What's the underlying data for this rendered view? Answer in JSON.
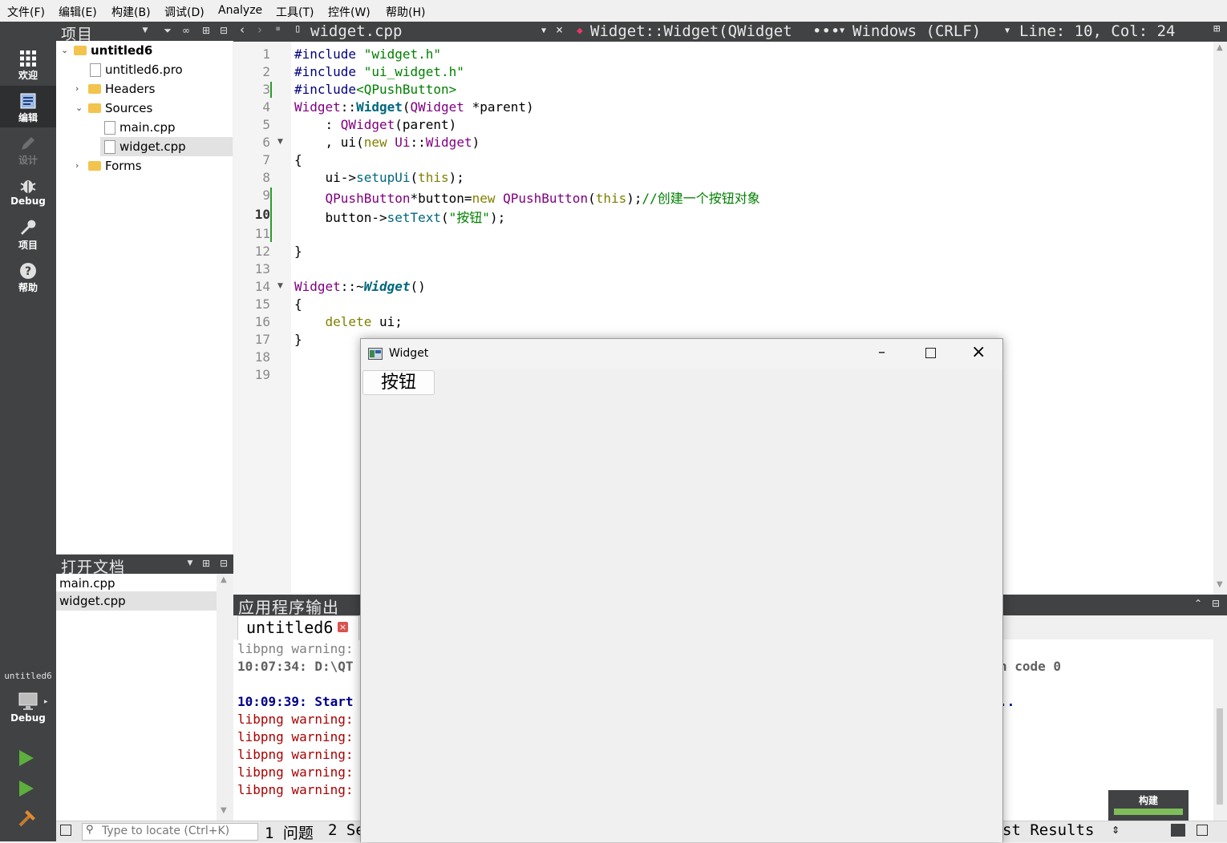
{
  "menu": [
    "文件(F)",
    "编辑(E)",
    "构建(B)",
    "调试(D)",
    "Analyze",
    "工具(T)",
    "控件(W)",
    "帮助(H)"
  ],
  "modes": [
    {
      "label": "欢迎",
      "icon": "grid-icon"
    },
    {
      "label": "编辑",
      "icon": "edit-document-icon"
    },
    {
      "label": "设计",
      "icon": "pencil-icon"
    },
    {
      "label": "Debug",
      "icon": "bug-icon"
    },
    {
      "label": "项目",
      "icon": "wrench-icon"
    },
    {
      "label": "帮助",
      "icon": "help-icon"
    }
  ],
  "kit": {
    "project": "untitled6",
    "config": "Debug"
  },
  "project_pane": {
    "title": "项目"
  },
  "tree": {
    "root": "untitled6",
    "pro": "untitled6.pro",
    "headers": "Headers",
    "sources": "Sources",
    "main": "main.cpp",
    "widget": "widget.cpp",
    "forms": "Forms"
  },
  "open_docs": {
    "title": "打开文档",
    "items": [
      "main.cpp",
      "widget.cpp"
    ]
  },
  "editor_toolbar": {
    "file": "widget.cpp",
    "symbol": "Widget::Widget(QWidget",
    "ellipsis": "•••",
    "line_ending": "Windows (CRLF)",
    "position": "Line: 10, Col: 24"
  },
  "code": {
    "line_numbers": [
      "1",
      "2",
      "3",
      "4",
      "5",
      "6",
      "7",
      "8",
      "9",
      "10",
      "11",
      "12",
      "13",
      "14",
      "15",
      "16",
      "17",
      "18",
      "19"
    ],
    "l1a": "#include ",
    "l1b": "\"widget.h\"",
    "l2a": "#include ",
    "l2b": "\"ui_widget.h\"",
    "l3a": "#include",
    "l3b": "<QPushButton>",
    "l4a": "Widget",
    "l4b": "::",
    "l4c": "Widget",
    "l4d": "(",
    "l4e": "QWidget",
    "l4f": " *parent)",
    "l5a": "    : ",
    "l5b": "QWidget",
    "l5c": "(parent)",
    "l6a": "    , ui(",
    "l6b": "new",
    "l6c": " ",
    "l6d": "Ui",
    "l6e": "::",
    "l6f": "Widget",
    "l6g": ")",
    "l7": "{",
    "l8a": "    ui->",
    "l8b": "setupUi",
    "l8c": "(",
    "l8d": "this",
    "l8e": ");",
    "l9a": "    ",
    "l9b": "QPushButton",
    "l9c": "*button=",
    "l9d": "new",
    "l9e": " ",
    "l9f": "QPushButton",
    "l9g": "(",
    "l9h": "this",
    "l9i": ");",
    "l9j": "//创建一个按钮对象",
    "l10a": "    button->",
    "l10b": "setText",
    "l10c": "(",
    "l10d": "\"按钮\"",
    "l10e": ");",
    "l12": "}",
    "l14a": "Widget",
    "l14b": "::~",
    "l14c": "Widget",
    "l14d": "()",
    "l15": "{",
    "l16a": "    ",
    "l16b": "delete",
    "l16c": " ui;",
    "l17": "}"
  },
  "output": {
    "title": "应用程序输出",
    "tab": "untitled6",
    "lines": [
      "libpng warning:",
      "10:07:34: D:\\QT",
      "10:09:39: Start",
      "libpng warning:",
      "libpng warning:",
      "libpng warning:",
      "libpng warning:",
      "libpng warning:"
    ],
    "right_fragment": "n code 0",
    "right_dots": ".."
  },
  "status": {
    "locator_placeholder": "Type to locate (Ctrl+K)",
    "issues": "1 问题",
    "search": "2 Se",
    "test_results": "st Results",
    "build_label": "构建"
  },
  "app_window": {
    "title": "Widget",
    "button": "按钮"
  },
  "colors": {
    "accent_green": "#5dae3d",
    "dark_panel": "#404244"
  }
}
